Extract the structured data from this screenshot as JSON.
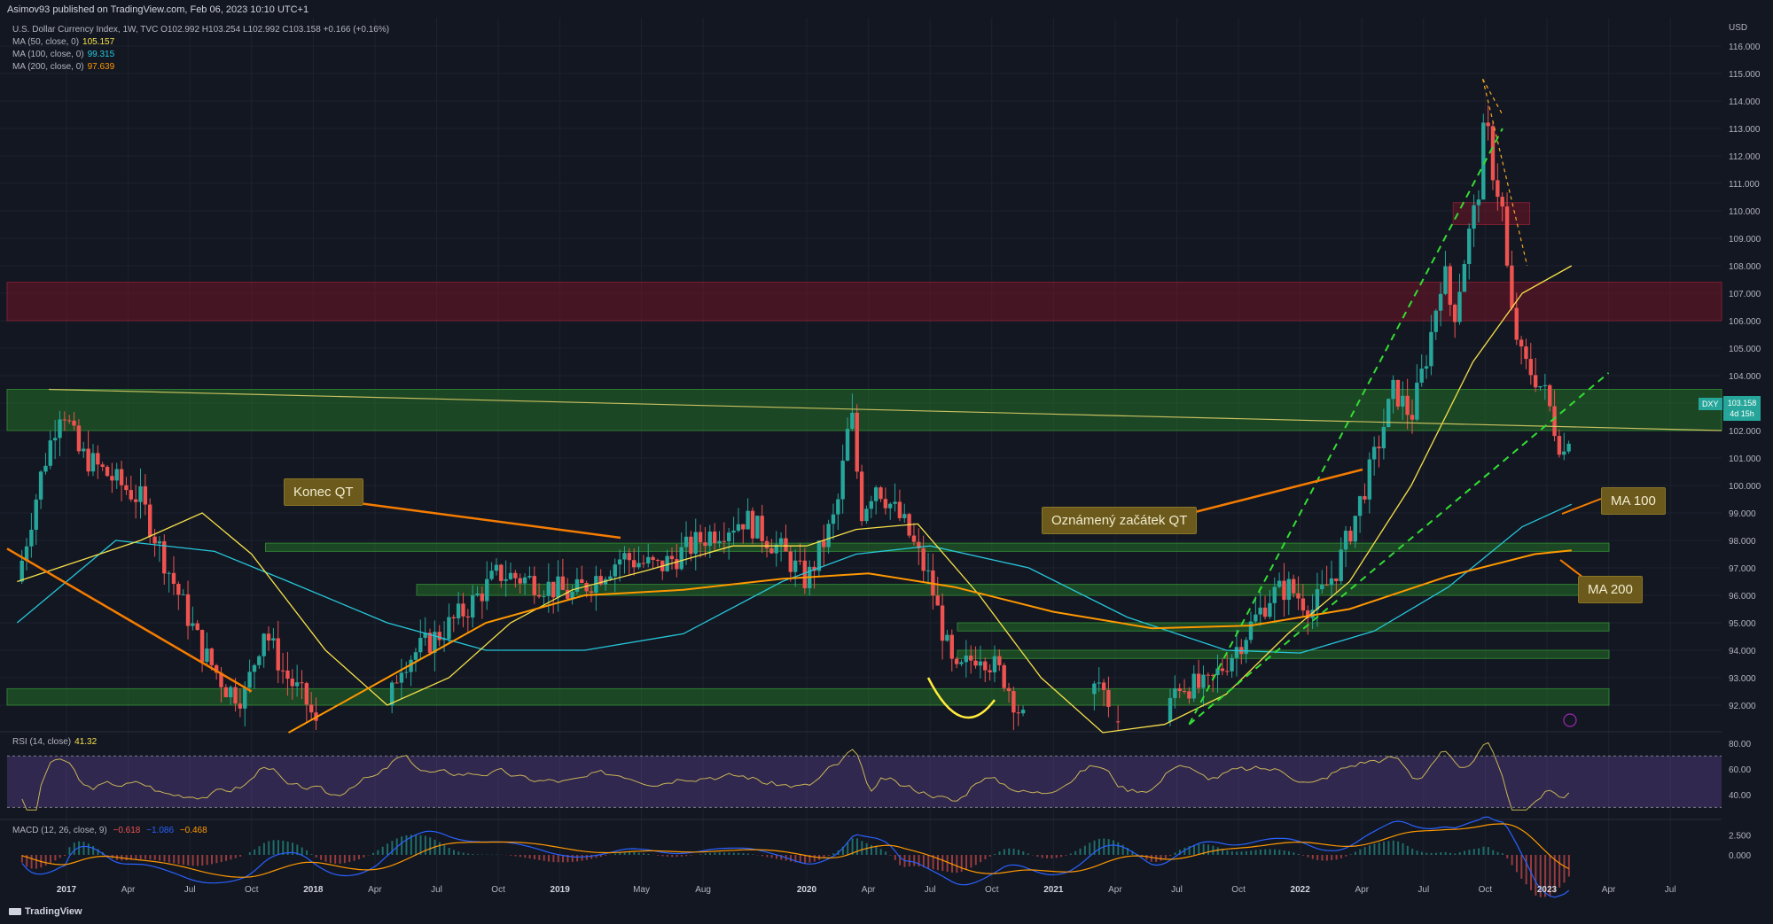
{
  "header": {
    "published": "Asimov93 published on TradingView.com, Feb 06, 2023 10:10 UTC+1",
    "ohlc_line": "U.S. Dollar Currency Index, 1W, TVC  O102.992  H103.254  L102.992  C103.158  +0.166 (+0.16%)"
  },
  "legend": [
    {
      "label": "MA (50, close, 0)",
      "value": "105.157",
      "color": "#f7e14a"
    },
    {
      "label": "MA (100, close, 0)",
      "value": "99.315",
      "color": "#26c6da"
    },
    {
      "label": "MA (200, close, 0)",
      "value": "97.639",
      "color": "#ff9800"
    }
  ],
  "price_axis": {
    "currency": "USD",
    "labels": [
      "116.000",
      "115.000",
      "114.000",
      "113.000",
      "112.000",
      "111.000",
      "110.000",
      "109.000",
      "108.000",
      "107.000",
      "106.000",
      "105.000",
      "104.000",
      "103.000",
      "102.000",
      "101.000",
      "100.000",
      "99.000",
      "98.000",
      "97.000",
      "96.000",
      "95.000",
      "94.000",
      "93.000",
      "92.000"
    ]
  },
  "last_price": {
    "symbol": "DXY",
    "price": "103.158",
    "countdown": "4d 15h"
  },
  "callouts": {
    "konec": "Konec QT",
    "oznameny": "Oznámený začátek QT",
    "ma100": "MA 100",
    "ma200": "MA 200"
  },
  "rsi": {
    "label": "RSI (14, close)",
    "value": "41.32",
    "levels": [
      "80.00",
      "60.00",
      "40.00"
    ]
  },
  "macd": {
    "label": "MACD (12, 26, close, 9)",
    "v1": "−0.618",
    "v2": "−1.086",
    "v3": "−0.468",
    "levels": [
      "2.500",
      "0.000"
    ]
  },
  "footer": "TradingView",
  "chart_data": {
    "type": "candlestick",
    "symbol": "DXY",
    "interval": "1W",
    "ylim": [
      91,
      117
    ],
    "time_axis": [
      {
        "label": "2017",
        "t": 2017.0
      },
      {
        "label": "Apr",
        "t": 2017.25
      },
      {
        "label": "Jul",
        "t": 2017.5
      },
      {
        "label": "Oct",
        "t": 2017.75
      },
      {
        "label": "2018",
        "t": 2018.0
      },
      {
        "label": "Apr",
        "t": 2018.25
      },
      {
        "label": "Jul",
        "t": 2018.5
      },
      {
        "label": "Oct",
        "t": 2018.75
      },
      {
        "label": "2019",
        "t": 2019.0
      },
      {
        "label": "May",
        "t": 2019.33
      },
      {
        "label": "Aug",
        "t": 2019.58
      },
      {
        "label": "2020",
        "t": 2020.0
      },
      {
        "label": "Apr",
        "t": 2020.25
      },
      {
        "label": "Jul",
        "t": 2020.5
      },
      {
        "label": "Oct",
        "t": 2020.75
      },
      {
        "label": "2021",
        "t": 2021.0
      },
      {
        "label": "Apr",
        "t": 2021.25
      },
      {
        "label": "Jul",
        "t": 2021.5
      },
      {
        "label": "Oct",
        "t": 2021.75
      },
      {
        "label": "2022",
        "t": 2022.0
      },
      {
        "label": "Apr",
        "t": 2022.25
      },
      {
        "label": "Jul",
        "t": 2022.5
      },
      {
        "label": "Oct",
        "t": 2022.75
      },
      {
        "label": "2023",
        "t": 2023.0
      },
      {
        "label": "Apr",
        "t": 2023.25
      },
      {
        "label": "Jul",
        "t": 2023.5
      }
    ],
    "price_path": [
      [
        2016.8,
        96.5
      ],
      [
        2016.9,
        100.5
      ],
      [
        2016.98,
        103.0
      ],
      [
        2017.05,
        101.2
      ],
      [
        2017.15,
        100.5
      ],
      [
        2017.3,
        99.5
      ],
      [
        2017.4,
        97.2
      ],
      [
        2017.55,
        94.0
      ],
      [
        2017.65,
        92.6
      ],
      [
        2017.72,
        92.3
      ],
      [
        2017.8,
        94.8
      ],
      [
        2017.88,
        93.2
      ],
      [
        2017.98,
        92.0
      ],
      [
        2018.08,
        89.4
      ],
      [
        2018.25,
        90.0
      ],
      [
        2018.35,
        93.5
      ],
      [
        2018.5,
        94.5
      ],
      [
        2018.62,
        95.5
      ],
      [
        2018.75,
        96.8
      ],
      [
        2018.9,
        96.5
      ],
      [
        2019.05,
        96.0
      ],
      [
        2019.25,
        97.4
      ],
      [
        2019.4,
        97.0
      ],
      [
        2019.6,
        98.2
      ],
      [
        2019.75,
        98.8
      ],
      [
        2019.9,
        97.6
      ],
      [
        2020.0,
        96.5
      ],
      [
        2020.12,
        99.0
      ],
      [
        2020.18,
        102.8
      ],
      [
        2020.22,
        99.0
      ],
      [
        2020.28,
        100.1
      ],
      [
        2020.4,
        98.5
      ],
      [
        2020.5,
        96.5
      ],
      [
        2020.6,
        93.0
      ],
      [
        2020.7,
        94.0
      ],
      [
        2020.8,
        93.0
      ],
      [
        2020.95,
        90.0
      ],
      [
        2021.05,
        90.2
      ],
      [
        2021.18,
        92.9
      ],
      [
        2021.3,
        90.8
      ],
      [
        2021.4,
        89.8
      ],
      [
        2021.5,
        92.8
      ],
      [
        2021.62,
        92.6
      ],
      [
        2021.75,
        94.2
      ],
      [
        2021.88,
        96.0
      ],
      [
        2021.95,
        96.3
      ],
      [
        2022.05,
        95.5
      ],
      [
        2022.15,
        97.0
      ],
      [
        2022.22,
        98.8
      ],
      [
        2022.3,
        101.0
      ],
      [
        2022.38,
        103.5
      ],
      [
        2022.45,
        102.5
      ],
      [
        2022.52,
        105.0
      ],
      [
        2022.58,
        108.0
      ],
      [
        2022.62,
        106.0
      ],
      [
        2022.68,
        109.0
      ],
      [
        2022.72,
        110.5
      ],
      [
        2022.75,
        113.5
      ],
      [
        2022.78,
        111.5
      ],
      [
        2022.82,
        110.0
      ],
      [
        2022.85,
        106.5
      ],
      [
        2022.9,
        104.5
      ],
      [
        2022.95,
        104.0
      ],
      [
        2023.0,
        103.2
      ],
      [
        2023.04,
        101.8
      ],
      [
        2023.08,
        101.0
      ],
      [
        2023.1,
        103.158
      ]
    ],
    "ma50": [
      [
        2016.8,
        96.5
      ],
      [
        2017.3,
        98.0
      ],
      [
        2017.55,
        99.0
      ],
      [
        2017.75,
        97.5
      ],
      [
        2018.05,
        94.0
      ],
      [
        2018.3,
        92.0
      ],
      [
        2018.55,
        93.0
      ],
      [
        2018.8,
        95.0
      ],
      [
        2019.05,
        96.2
      ],
      [
        2019.35,
        96.9
      ],
      [
        2019.7,
        97.8
      ],
      [
        2020.0,
        97.8
      ],
      [
        2020.2,
        98.4
      ],
      [
        2020.45,
        98.6
      ],
      [
        2020.7,
        96.0
      ],
      [
        2020.95,
        93.0
      ],
      [
        2021.2,
        91.0
      ],
      [
        2021.45,
        91.3
      ],
      [
        2021.7,
        92.4
      ],
      [
        2021.95,
        94.6
      ],
      [
        2022.2,
        96.5
      ],
      [
        2022.45,
        100.0
      ],
      [
        2022.7,
        104.5
      ],
      [
        2022.9,
        107.0
      ],
      [
        2023.1,
        108.0
      ]
    ],
    "ma100": [
      [
        2016.8,
        95.0
      ],
      [
        2017.2,
        98.0
      ],
      [
        2017.6,
        97.6
      ],
      [
        2017.9,
        96.5
      ],
      [
        2018.3,
        95.0
      ],
      [
        2018.7,
        94.0
      ],
      [
        2019.1,
        94.0
      ],
      [
        2019.5,
        94.6
      ],
      [
        2019.9,
        96.5
      ],
      [
        2020.2,
        97.5
      ],
      [
        2020.5,
        97.8
      ],
      [
        2020.9,
        97.0
      ],
      [
        2021.3,
        95.2
      ],
      [
        2021.7,
        94.0
      ],
      [
        2022.0,
        93.9
      ],
      [
        2022.3,
        94.7
      ],
      [
        2022.6,
        96.3
      ],
      [
        2022.9,
        98.5
      ],
      [
        2023.1,
        99.315
      ]
    ],
    "ma200": [
      [
        2017.9,
        91.0
      ],
      [
        2018.3,
        93.0
      ],
      [
        2018.7,
        95.0
      ],
      [
        2019.1,
        96.0
      ],
      [
        2019.5,
        96.2
      ],
      [
        2019.9,
        96.6
      ],
      [
        2020.25,
        96.8
      ],
      [
        2020.6,
        96.3
      ],
      [
        2021.0,
        95.4
      ],
      [
        2021.4,
        94.8
      ],
      [
        2021.8,
        94.9
      ],
      [
        2022.2,
        95.5
      ],
      [
        2022.6,
        96.7
      ],
      [
        2022.95,
        97.5
      ],
      [
        2023.1,
        97.639
      ]
    ],
    "zones": [
      {
        "from": 106.0,
        "to": 107.4,
        "color": "red"
      },
      {
        "from": 109.5,
        "to": 110.3,
        "color": "red"
      },
      {
        "from": 102.0,
        "to": 103.5,
        "color": "green"
      },
      {
        "from": 97.6,
        "to": 97.9,
        "color": "green"
      },
      {
        "from": 96.0,
        "to": 96.4,
        "color": "green"
      },
      {
        "from": 94.7,
        "to": 95.0,
        "color": "green"
      },
      {
        "from": 93.7,
        "to": 94.0,
        "color": "green"
      },
      {
        "from": 92.0,
        "to": 92.6,
        "color": "green"
      }
    ]
  }
}
